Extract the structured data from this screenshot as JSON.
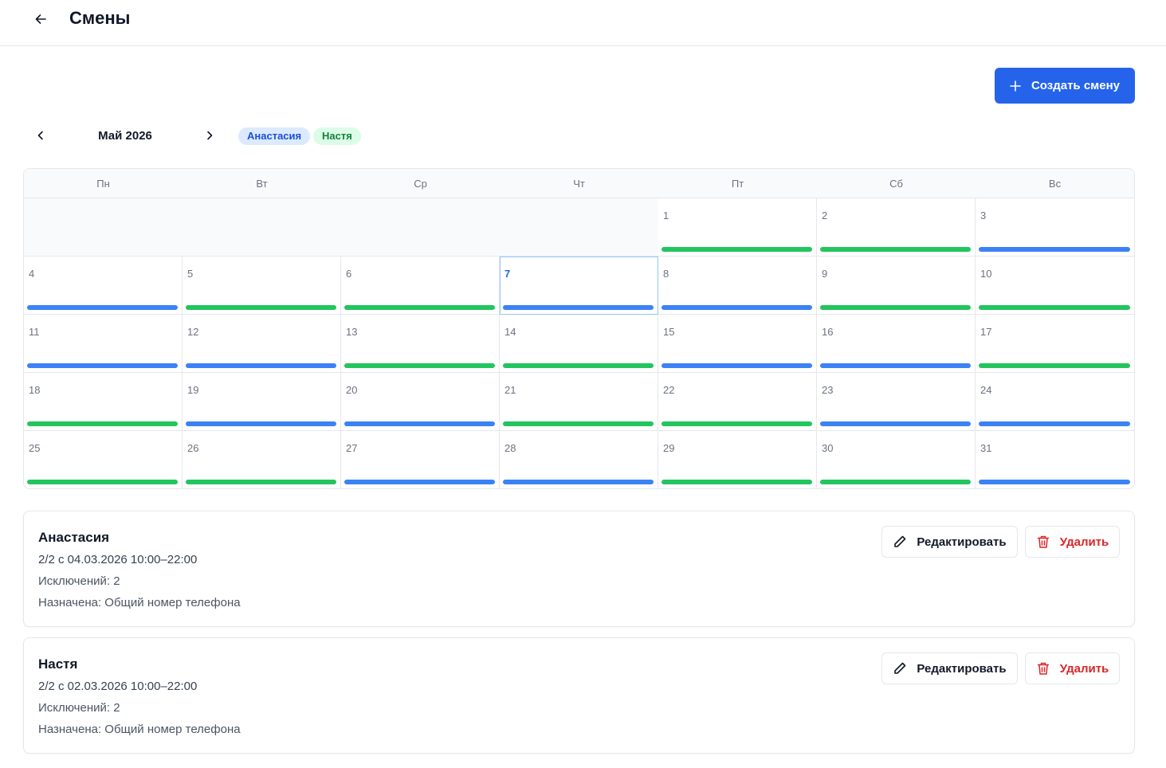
{
  "header": {
    "title": "Смены",
    "back_icon": "arrow-left-icon"
  },
  "toolbar": {
    "create_label": "Создать смену",
    "create_icon": "plus-icon",
    "accent": "#2563eb"
  },
  "calendar": {
    "month_label": "Май 2026",
    "prev_icon": "chevron-left-icon",
    "next_icon": "chevron-right-icon",
    "legend": [
      {
        "label": "Анастасия",
        "color": "#3b82f6"
      },
      {
        "label": "Настя",
        "color": "#22c55e"
      }
    ],
    "weekdays": [
      "Пн",
      "Вт",
      "Ср",
      "Чт",
      "Пт",
      "Сб",
      "Вс"
    ],
    "first_weekday_index": 4,
    "today": 7,
    "days": [
      {
        "n": "1",
        "who": 1
      },
      {
        "n": "2",
        "who": 1
      },
      {
        "n": "3",
        "who": 0
      },
      {
        "n": "4",
        "who": 0
      },
      {
        "n": "5",
        "who": 1
      },
      {
        "n": "6",
        "who": 1
      },
      {
        "n": "7",
        "who": 0
      },
      {
        "n": "8",
        "who": 0
      },
      {
        "n": "9",
        "who": 1
      },
      {
        "n": "10",
        "who": 1
      },
      {
        "n": "11",
        "who": 0
      },
      {
        "n": "12",
        "who": 0
      },
      {
        "n": "13",
        "who": 1
      },
      {
        "n": "14",
        "who": 1
      },
      {
        "n": "15",
        "who": 0
      },
      {
        "n": "16",
        "who": 0
      },
      {
        "n": "17",
        "who": 1
      },
      {
        "n": "18",
        "who": 1
      },
      {
        "n": "19",
        "who": 0
      },
      {
        "n": "20",
        "who": 0
      },
      {
        "n": "21",
        "who": 1
      },
      {
        "n": "22",
        "who": 1
      },
      {
        "n": "23",
        "who": 0
      },
      {
        "n": "24",
        "who": 0
      },
      {
        "n": "25",
        "who": 1
      },
      {
        "n": "26",
        "who": 1
      },
      {
        "n": "27",
        "who": 0
      },
      {
        "n": "28",
        "who": 0
      },
      {
        "n": "29",
        "who": 1
      },
      {
        "n": "30",
        "who": 1
      },
      {
        "n": "31",
        "who": 0
      }
    ]
  },
  "shifts": [
    {
      "name": "Анастасия",
      "schedule": "2/2 с 04.03.2026 10:00–22:00",
      "exceptions": "Исключений: 2",
      "assigned": "Назначена: Общий номер телефона",
      "edit_label": "Редактировать",
      "delete_label": "Удалить"
    },
    {
      "name": "Настя",
      "schedule": "2/2 с 02.03.2026 10:00–22:00",
      "exceptions": "Исключений: 2",
      "assigned": "Назначена: Общий номер телефона",
      "edit_label": "Редактировать",
      "delete_label": "Удалить"
    }
  ]
}
